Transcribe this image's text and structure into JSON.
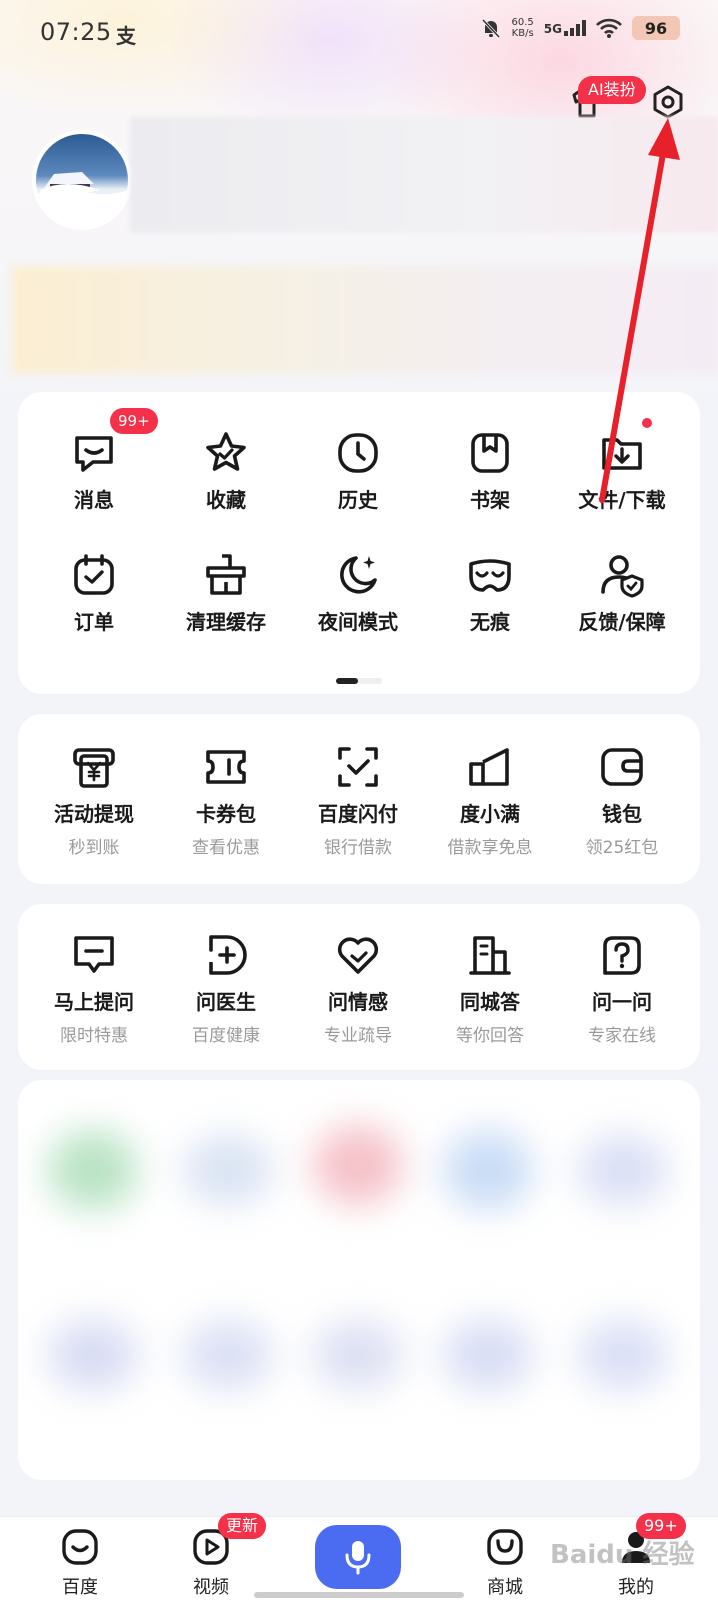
{
  "status_bar": {
    "time": "07:25",
    "app_icon": "支",
    "net_speed_value": "60.5",
    "net_speed_unit": "KB/s",
    "network": "5G",
    "battery": "96"
  },
  "header": {
    "ai_tag": "AI装扮",
    "shirt_icon": "shirt-icon",
    "settings_icon": "gear-icon"
  },
  "tools": {
    "row1": [
      {
        "label": "消息",
        "icon": "message-icon",
        "badge": "99+"
      },
      {
        "label": "收藏",
        "icon": "star-icon"
      },
      {
        "label": "历史",
        "icon": "clock-icon"
      },
      {
        "label": "书架",
        "icon": "bookmark-icon"
      },
      {
        "label": "文件/下载",
        "icon": "download-folder-icon",
        "dot": true
      }
    ],
    "row2": [
      {
        "label": "订单",
        "icon": "calendar-check-icon"
      },
      {
        "label": "清理缓存",
        "icon": "broom-icon"
      },
      {
        "label": "夜间模式",
        "icon": "moon-icon"
      },
      {
        "label": "无痕",
        "icon": "mask-icon"
      },
      {
        "label": "反馈/保障",
        "icon": "user-shield-icon"
      }
    ]
  },
  "finance": [
    {
      "label": "活动提现",
      "sub": "秒到账",
      "icon": "yen-ticket-icon"
    },
    {
      "label": "卡券包",
      "sub": "查看优惠",
      "icon": "coupon-icon"
    },
    {
      "label": "百度闪付",
      "sub": "银行借款",
      "icon": "scan-check-icon"
    },
    {
      "label": "度小满",
      "sub": "借款享免息",
      "icon": "duxiaoman-icon"
    },
    {
      "label": "钱包",
      "sub": "领25红包",
      "icon": "wallet-icon"
    }
  ],
  "services": [
    {
      "label": "马上提问",
      "sub": "限时特惠",
      "icon": "question-bubble-icon"
    },
    {
      "label": "问医生",
      "sub": "百度健康",
      "icon": "medical-icon"
    },
    {
      "label": "问情感",
      "sub": "专业疏导",
      "icon": "heart-icon"
    },
    {
      "label": "同城答",
      "sub": "等你回答",
      "icon": "building-icon"
    },
    {
      "label": "问一问",
      "sub": "专家在线",
      "icon": "help-icon"
    }
  ],
  "tabbar": [
    {
      "label": "百度",
      "icon": "baidu-home-icon"
    },
    {
      "label": "视频",
      "icon": "video-icon",
      "badge": "更新"
    },
    {
      "label": "",
      "icon": "mic-icon"
    },
    {
      "label": "商城",
      "icon": "shop-bag-icon"
    },
    {
      "label": "我的",
      "icon": "profile-icon",
      "badge": "99+"
    }
  ],
  "watermark": "Baidu 经验",
  "colors": {
    "accent_red": "#f5314a",
    "mic_blue": "#4b6cf0",
    "arrow_red": "#e8202a"
  }
}
